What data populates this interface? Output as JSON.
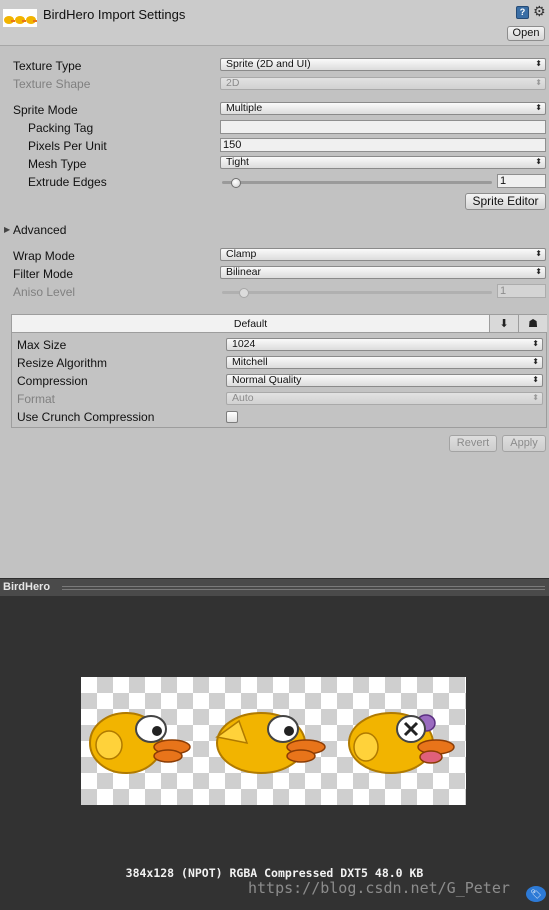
{
  "header": {
    "title": "BirdHero Import Settings",
    "open_label": "Open",
    "icons": [
      "texture-thumbnail-icon",
      "help-icon",
      "gear-icon"
    ]
  },
  "texture": {
    "texture_type_label": "Texture Type",
    "texture_type_value": "Sprite (2D and UI)",
    "texture_shape_label": "Texture Shape",
    "texture_shape_value": "2D",
    "sprite_mode_label": "Sprite Mode",
    "sprite_mode_value": "Multiple",
    "packing_tag_label": "Packing Tag",
    "packing_tag_value": "",
    "pixels_per_unit_label": "Pixels Per Unit",
    "pixels_per_unit_value": "150",
    "mesh_type_label": "Mesh Type",
    "mesh_type_value": "Tight",
    "extrude_edges_label": "Extrude Edges",
    "extrude_edges_value": "1",
    "extrude_edges_max": 32,
    "sprite_editor_label": "Sprite Editor",
    "advanced_label": "Advanced",
    "wrap_mode_label": "Wrap Mode",
    "wrap_mode_value": "Clamp",
    "filter_mode_label": "Filter Mode",
    "filter_mode_value": "Bilinear",
    "aniso_level_label": "Aniso Level",
    "aniso_level_value": "1",
    "aniso_level_max": 16
  },
  "platform": {
    "tab_label": "Default",
    "tab_icons": [
      "download-icon",
      "android-icon"
    ],
    "max_size_label": "Max Size",
    "max_size_value": "1024",
    "resize_label": "Resize Algorithm",
    "resize_value": "Mitchell",
    "compression_label": "Compression",
    "compression_value": "Normal Quality",
    "format_label": "Format",
    "format_value": "Auto",
    "crunch_label": "Use Crunch Compression",
    "crunch_checked": false
  },
  "actions": {
    "revert_label": "Revert",
    "apply_label": "Apply"
  },
  "preview": {
    "name": "BirdHero",
    "info": "384x128 (NPOT)  RGBA Compressed DXT5   48.0 KB",
    "watermark": "https://blog.csdn.net/G_Peter",
    "colors": {
      "bird_body": "#f2b400",
      "beak": "#e8741a",
      "background": "#323232"
    }
  }
}
